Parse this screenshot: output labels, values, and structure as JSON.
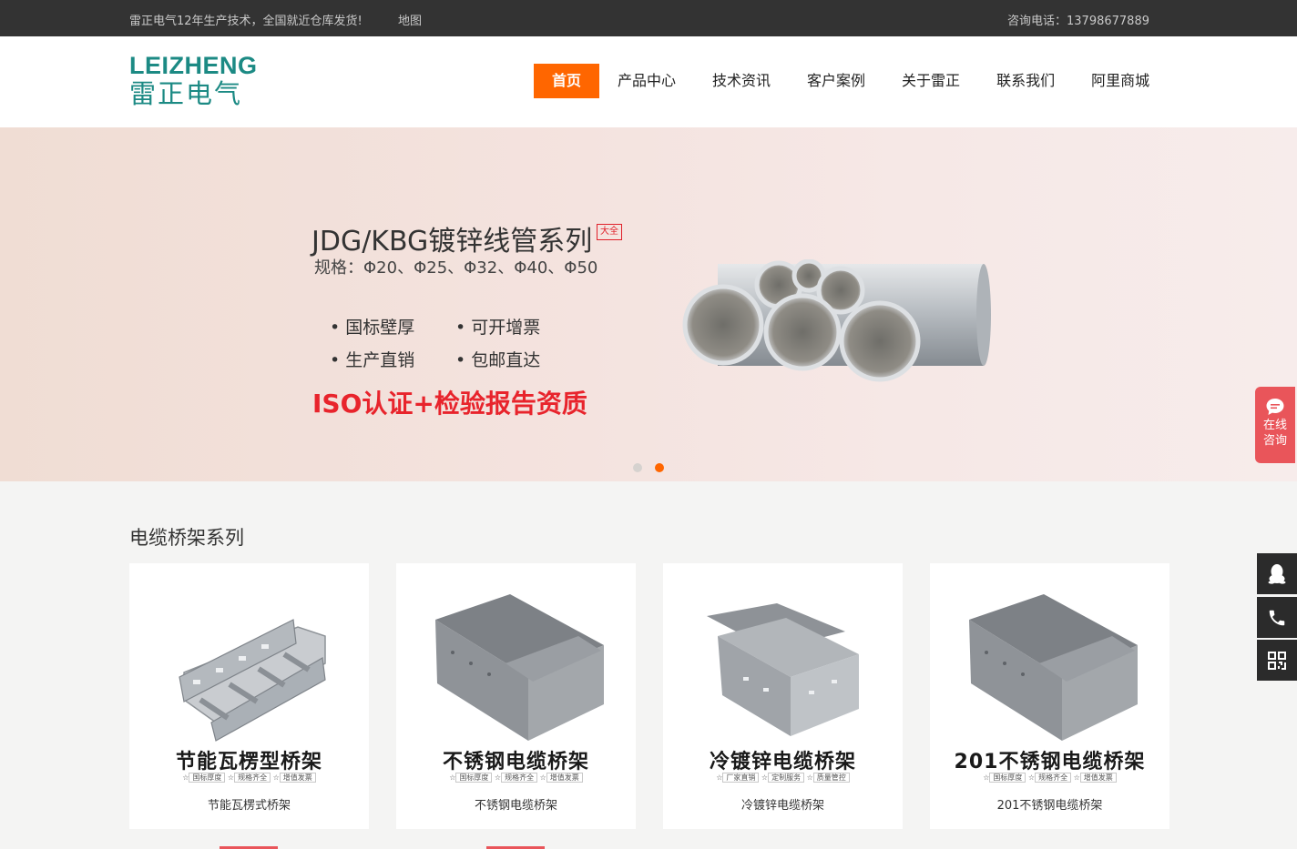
{
  "topbar": {
    "notice": "雷正电气12年生产技术，全国就近仓库发货!",
    "map_link": "地图",
    "phone": "咨询电话：13798677889"
  },
  "logo": {
    "en": "LEIZHENG",
    "zh": "雷正电气"
  },
  "nav": {
    "items": [
      {
        "label": "首页"
      },
      {
        "label": "产品中心"
      },
      {
        "label": "技术资讯"
      },
      {
        "label": "客户案例"
      },
      {
        "label": "关于雷正"
      },
      {
        "label": "联系我们"
      },
      {
        "label": "阿里商城"
      }
    ]
  },
  "banner": {
    "title": "JDG/KBG镀锌线管系列",
    "badge": "大全",
    "spec": "规格：Φ20、Φ25、Φ32、Φ40、Φ50",
    "features": [
      "• 国标壁厚",
      "• 可开增票",
      "• 生产直销",
      "• 包邮直达"
    ],
    "cert": "ISO认证+检验报告资质",
    "slide_count": 2,
    "active_slide": 2
  },
  "section": {
    "title": "电缆桥架系列"
  },
  "products": [
    {
      "big_label": "节能瓦楞型桥架",
      "tags": [
        "国标厚度",
        "规格齐全",
        "增值发票"
      ],
      "name": "节能瓦楞式桥架",
      "icon": "ladder-tray-image"
    },
    {
      "big_label": "不锈钢电缆桥架",
      "tags": [
        "国标厚度",
        "规格齐全",
        "增值发票"
      ],
      "name": "不锈钢电缆桥架",
      "icon": "covered-tray-image"
    },
    {
      "big_label": "冷镀锌电缆桥架",
      "tags": [
        "厂家直销",
        "定制服务",
        "质量管控"
      ],
      "name": "冷镀锌电缆桥架",
      "icon": "perforated-tray-image"
    },
    {
      "big_label": "201不锈钢电缆桥架",
      "tags": [
        "国标厚度",
        "规格齐全",
        "增值发票"
      ],
      "name": "201不锈钢电缆桥架",
      "icon": "covered-tray-image"
    }
  ],
  "side": {
    "consult_label_1": "在线",
    "consult_label_2": "咨询"
  },
  "colors": {
    "accent": "#ff6600",
    "brand": "#1c8a84",
    "consult": "#e9555a",
    "cert": "#e8242c"
  }
}
